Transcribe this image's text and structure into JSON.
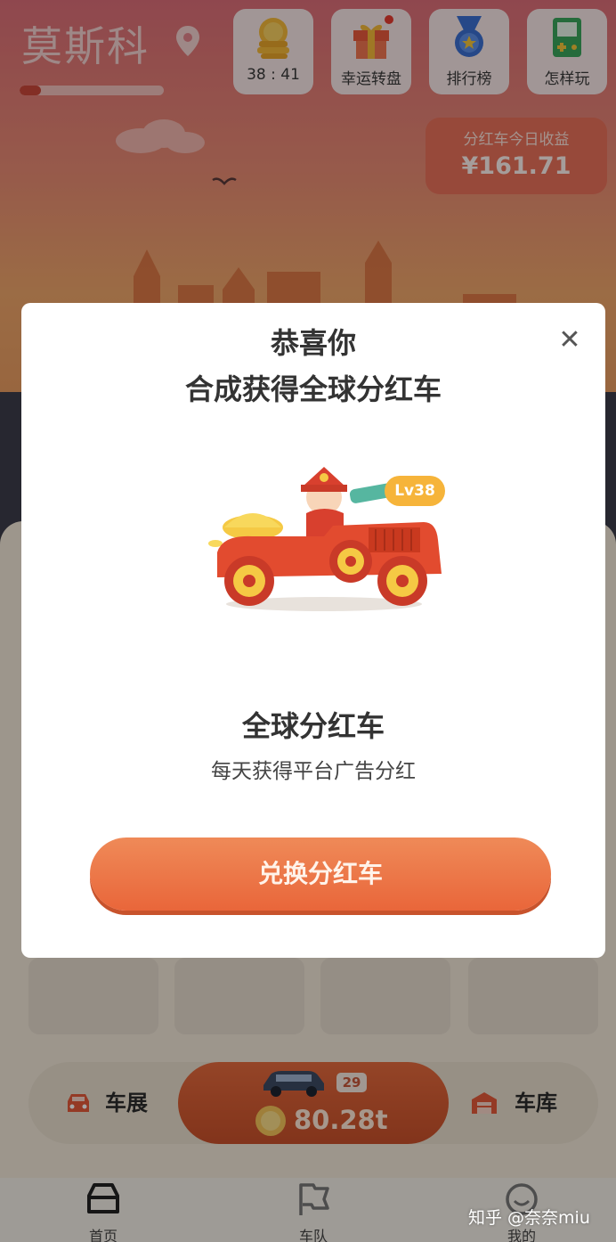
{
  "header": {
    "city": "莫斯科",
    "progress_fraction": 0.15,
    "buttons": [
      {
        "label": "38 : 41",
        "icon": "gold-coin-stack-icon"
      },
      {
        "label": "幸运转盘",
        "icon": "gift-box-icon"
      },
      {
        "label": "排行榜",
        "icon": "medal-icon"
      },
      {
        "label": "怎样玩",
        "icon": "handheld-game-icon"
      }
    ],
    "income_title": "分红车今日收益",
    "income_value": "¥161.71"
  },
  "modal": {
    "title_line1": "恭喜你",
    "title_line2": "合成获得全球分红车",
    "close_icon": "close-icon",
    "level_badge": "Lv38",
    "car_name": "全球分红车",
    "description": "每天获得平台广告分红",
    "action_label": "兑换分红车"
  },
  "bottom": {
    "left_label": "车展",
    "right_label": "车库",
    "center_badge": "29",
    "coin_value": "80.28t"
  },
  "tabs": [
    {
      "label": "首页",
      "icon": "car-front-icon"
    },
    {
      "label": "车队",
      "icon": "flag-icon"
    },
    {
      "label": "我的",
      "icon": "smile-icon"
    }
  ],
  "watermark": "知乎 @奈奈miu",
  "colors": {
    "accent": "#e9663a",
    "sky_top": "#dc6e78",
    "lv_badge": "#f6b43a"
  }
}
